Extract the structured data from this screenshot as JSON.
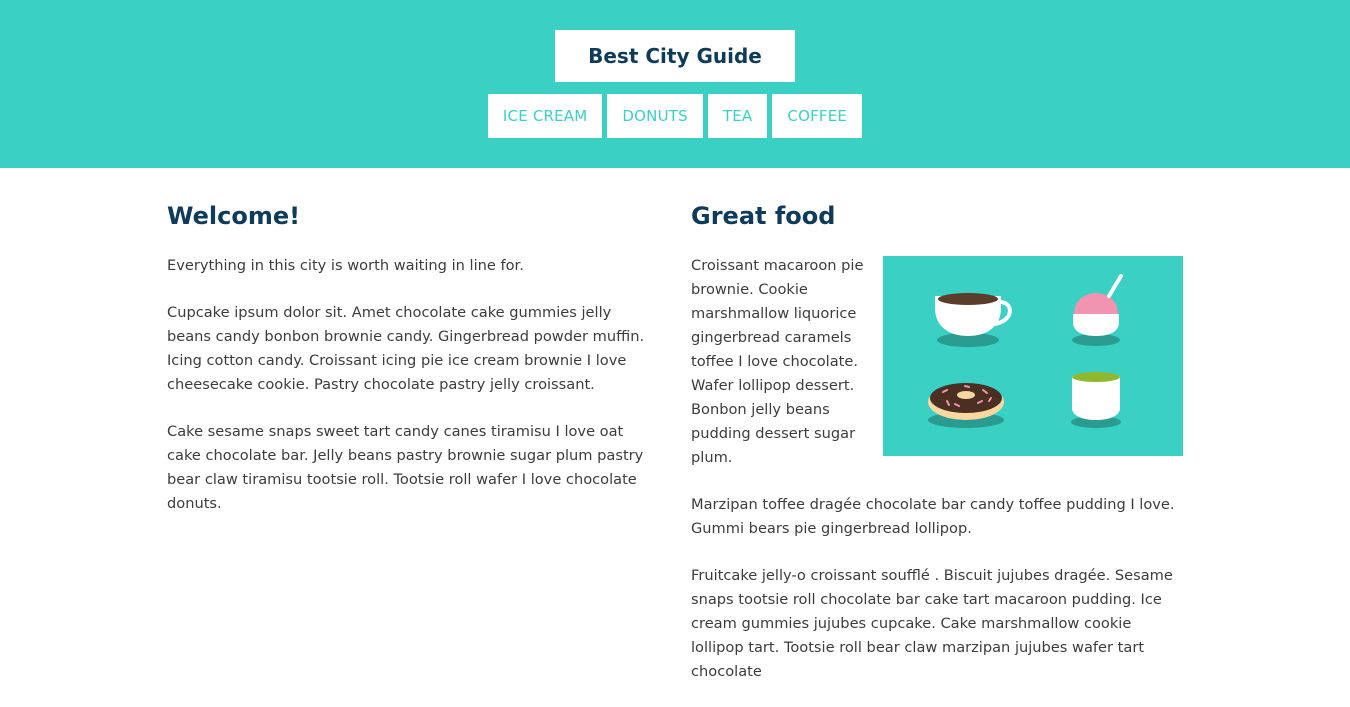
{
  "header": {
    "title": "Best City Guide",
    "nav": [
      {
        "label": "ICE CREAM"
      },
      {
        "label": "DONUTS"
      },
      {
        "label": "TEA"
      },
      {
        "label": "COFFEE"
      }
    ]
  },
  "left": {
    "heading": "Welcome!",
    "paragraphs": [
      "Everything in this city is worth waiting in line for.",
      "Cupcake ipsum dolor sit. Amet chocolate cake gummies jelly beans candy bonbon brownie candy. Gingerbread powder muffin. Icing cotton candy. Croissant icing pie ice cream brownie I love cheesecake cookie. Pastry chocolate pastry jelly croissant.",
      "Cake sesame snaps sweet tart candy canes tiramisu I love oat cake chocolate bar. Jelly beans pastry brownie sugar plum pastry bear claw tiramisu tootsie roll. Tootsie roll wafer I love chocolate donuts."
    ]
  },
  "right": {
    "heading": "Great food",
    "image_icons": [
      "coffee-cup-icon",
      "ice-cream-icon",
      "donut-icon",
      "tea-cup-icon"
    ],
    "paragraphs": [
      "Croissant macaroon pie brownie. Cookie marshmallow liquorice gingerbread caramels toffee I love chocolate. Wafer lollipop dessert. Bonbon jelly beans pudding dessert sugar plum.",
      "Marzipan toffee dragée chocolate bar candy toffee pudding I love. Gummi bears pie gingerbread lollipop.",
      "Fruitcake jelly-o croissant soufflé . Biscuit jujubes dragée. Sesame snaps tootsie roll chocolate bar cake tart macaroon pudding. Ice cream gummies jujubes cupcake. Cake marshmallow cookie lollipop tart. Tootsie roll bear claw marzipan jujubes wafer tart chocolate"
    ]
  },
  "colors": {
    "accent": "#3ad0c4",
    "heading": "#0e3b59",
    "text": "#3c3c3c"
  }
}
